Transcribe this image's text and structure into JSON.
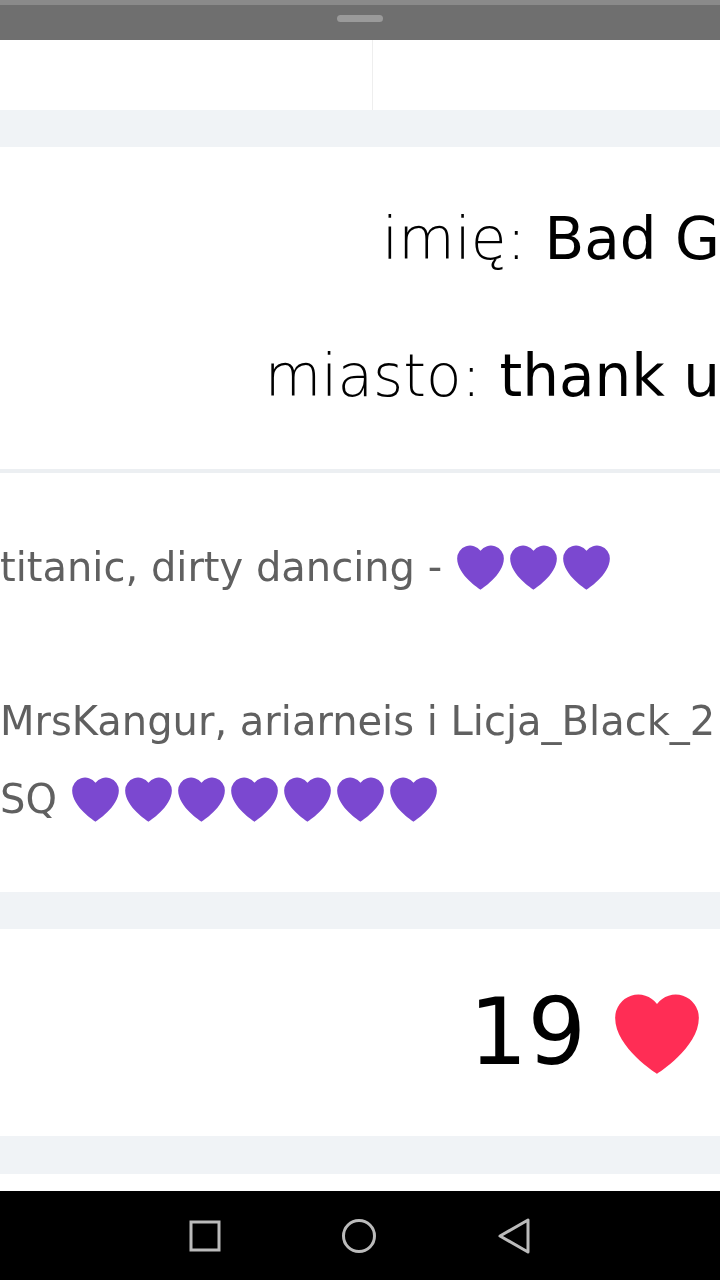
{
  "profile": {
    "fields": [
      {
        "label": "imię:",
        "value": "Bad G"
      },
      {
        "label": "miasto:",
        "value": "thank u"
      }
    ]
  },
  "comments": [
    [
      {
        "kind": "text",
        "text": "titanic, dirty dancing -"
      },
      {
        "kind": "heart"
      },
      {
        "kind": "heart"
      },
      {
        "kind": "heart"
      }
    ],
    [
      {
        "kind": "text",
        "text": "MrsKangur, ariarneis i Licja_Black_2"
      }
    ],
    [
      {
        "kind": "text",
        "text": "SQ"
      },
      {
        "kind": "heart"
      },
      {
        "kind": "heart"
      },
      {
        "kind": "heart"
      },
      {
        "kind": "heart"
      },
      {
        "kind": "heart"
      },
      {
        "kind": "heart"
      },
      {
        "kind": "heart"
      }
    ]
  ],
  "likes": {
    "count": "19"
  }
}
